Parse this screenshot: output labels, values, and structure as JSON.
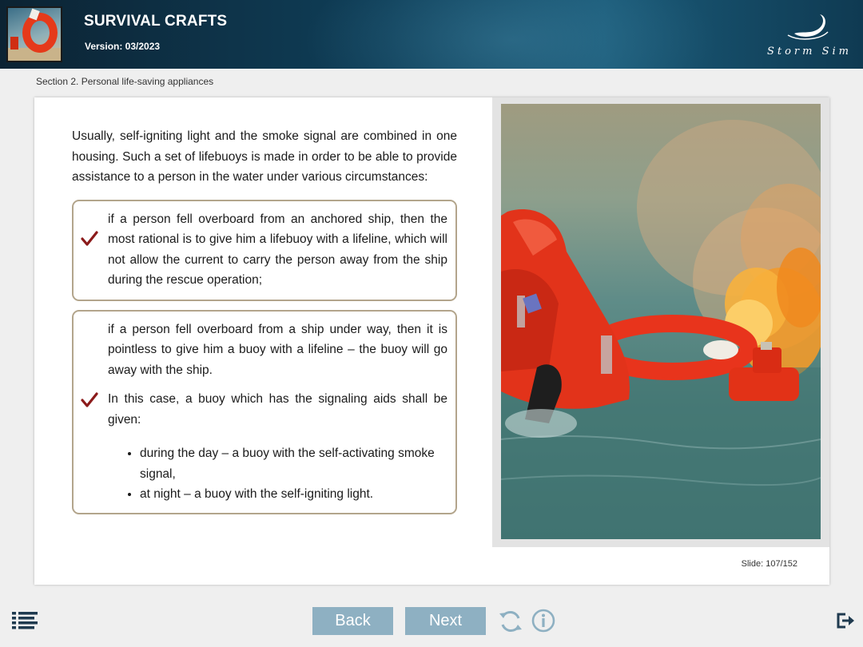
{
  "header": {
    "title": "SURVIVAL CRAFTS",
    "version": "Version: 03/2023",
    "logo_text": "Storm Sim",
    "thumbnail_icon": "lifebuoy-thumbnail",
    "colors": {
      "header_dark": "#0c2333",
      "header_light": "#1a5a78"
    }
  },
  "breadcrumb": "Section 2. Personal life-saving appliances",
  "content": {
    "intro": "Usually, self-igniting light and the smoke signal are combined in one housing. Such a set of lifebuoys is made in order to be able to provide assistance to a person in the water under various circumstances:",
    "points": [
      {
        "icon": "check-icon",
        "paragraphs": [
          "if a person fell overboard from an anchored ship, then the most rational is to give him a lifebuoy with a lifeline, which will not allow the current to carry the person away from the ship during the rescue operation;"
        ]
      },
      {
        "icon": "check-icon",
        "paragraphs": [
          "if a person fell overboard from a ship under way, then it is pointless to give him a buoy with a lifeline – the buoy will go away with the ship.",
          "In this case, a buoy which has the signaling aids shall be given:"
        ],
        "bullets": [
          "during the day – a buoy with the self-activating smoke signal,",
          "at night – a buoy with the self-igniting light."
        ]
      }
    ],
    "image_icon": "person-in-water-with-smoke-signal-photo",
    "colors": {
      "check": "#8b1a1a",
      "box_border": "#b3a58c"
    }
  },
  "slide_info": "Slide:  107/152",
  "nav": {
    "back_label": "Back",
    "next_label": "Next",
    "menu_icon": "menu-list-icon",
    "reload_icon": "reload-icon",
    "info_icon": "info-icon",
    "exit_icon": "exit-icon",
    "colors": {
      "button": "#8eb0c2",
      "icon": "#8eb0c2",
      "dark_icon": "#1f3a4f"
    }
  }
}
